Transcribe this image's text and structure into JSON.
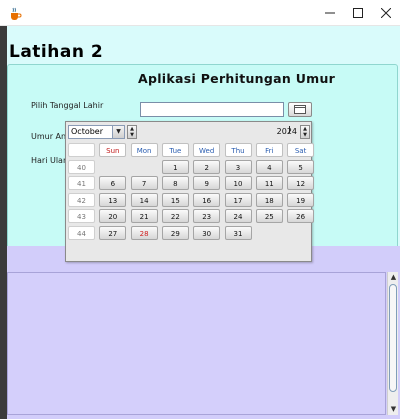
{
  "window": {
    "minimize_label": "—",
    "maximize_label": "☐",
    "close_label": "✕",
    "icon": "java-cup-icon"
  },
  "heading": "Latihan 2",
  "form": {
    "title": "Aplikasi Perhitungan Umur",
    "date_label": "Pilih Tanggal Lahir",
    "age_label": "Umur And",
    "day_label": "Hari Ulang",
    "date_value": ""
  },
  "calendar": {
    "month": "October",
    "year": "2024",
    "today": "28",
    "weekdays": [
      "Sun",
      "Mon",
      "Tue",
      "Wed",
      "Thu",
      "Fri",
      "Sat"
    ],
    "weeks": [
      {
        "num": "40",
        "days": [
          "",
          "",
          "1",
          "2",
          "3",
          "4",
          "5"
        ]
      },
      {
        "num": "41",
        "days": [
          "6",
          "7",
          "8",
          "9",
          "10",
          "11",
          "12"
        ]
      },
      {
        "num": "42",
        "days": [
          "13",
          "14",
          "15",
          "16",
          "17",
          "18",
          "19"
        ]
      },
      {
        "num": "43",
        "days": [
          "20",
          "21",
          "22",
          "23",
          "24",
          "25",
          "26"
        ]
      },
      {
        "num": "44",
        "days": [
          "27",
          "28",
          "29",
          "30",
          "31",
          "",
          ""
        ]
      }
    ]
  },
  "colors": {
    "frame_bg": "#d9fbfb",
    "panel_bg": "#c7fbf6",
    "textarea_bg": "#d4cffb",
    "weekday_text": "#2a5db0",
    "sunday_text": "#c01818",
    "today_text": "#d02020"
  }
}
